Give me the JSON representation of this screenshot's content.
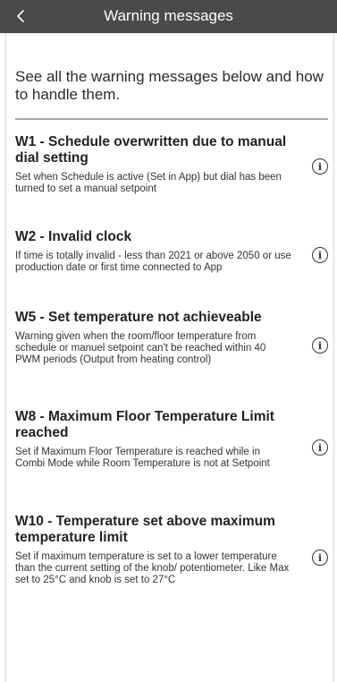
{
  "header": {
    "title": "Warning messages",
    "back_icon": "chevron-left-icon"
  },
  "intro": {
    "text": "See all the warning messages below and how to handle them."
  },
  "warnings": [
    {
      "title": "W1 - Schedule overwritten due to manual dial setting",
      "description": "Set when Schedule is active (Set in App) but dial has been turned to set a manual setpoint",
      "info_icon": "info-icon"
    },
    {
      "title": "W2 - Invalid clock",
      "description": "If time is totally invalid - less than 2021 or above 2050 or use production date or first time connected to App",
      "info_icon": "info-icon"
    },
    {
      "title": "W5 - Set temperature not achieveable",
      "description": "Warning given when the room/floor temperature from schedule or manuel setpoint can't be reached within 40 PWM periods (Output from heating control)",
      "info_icon": "info-icon"
    },
    {
      "title": "W8 - Maximum Floor Temperature Limit reached",
      "description": "Set if Maximum Floor Temperature is reached while in Combi Mode while Room Temperature is not at Setpoint",
      "info_icon": "info-icon"
    },
    {
      "title": "W10 - Temperature set above maximum temperature limit",
      "description": "Set if maximum temperature is set to a lower temperature than the current setting of the knob/ potentiometer. Like Max set to 25°C and knob is set to 27°C",
      "info_icon": "info-icon"
    }
  ],
  "colors": {
    "header_bg": "#4a4a4a",
    "header_text": "#ffffff",
    "divider": "#a8a8a8",
    "text": "#222222"
  }
}
